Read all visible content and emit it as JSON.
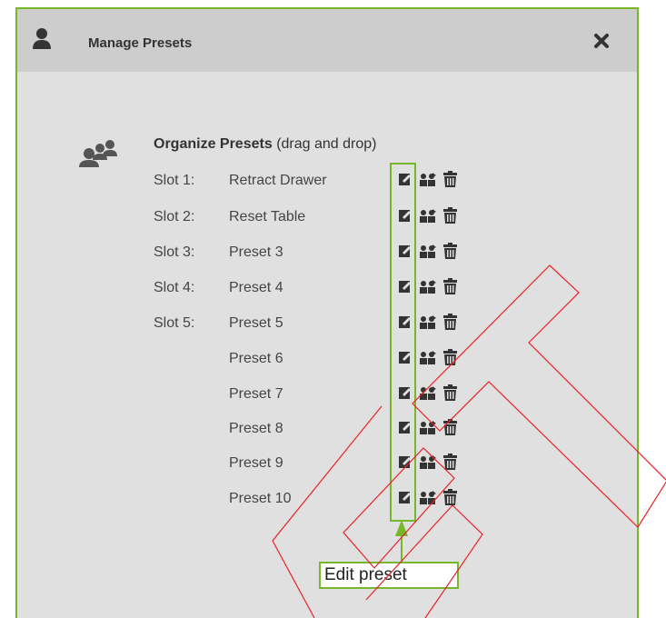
{
  "dialog": {
    "title": "Manage Presets",
    "heading_bold": "Organize Presets",
    "heading_hint": "(drag and drop)"
  },
  "slots": [
    {
      "slot": "Slot 1:",
      "name": "Retract Drawer"
    },
    {
      "slot": "Slot 2:",
      "name": "Reset Table"
    },
    {
      "slot": "Slot 3:",
      "name": "Preset 3"
    },
    {
      "slot": "Slot 4:",
      "name": "Preset 4"
    },
    {
      "slot": "Slot 5:",
      "name": "Preset 5"
    },
    {
      "slot": "",
      "name": "Preset 6"
    },
    {
      "slot": "",
      "name": "Preset 7"
    },
    {
      "slot": "",
      "name": "Preset 8"
    },
    {
      "slot": "",
      "name": "Preset 9"
    },
    {
      "slot": "",
      "name": "Preset 10"
    }
  ],
  "callout": {
    "label": "Edit preset"
  },
  "icons": {
    "user": "user-icon",
    "close": "close-icon",
    "group": "group-icon",
    "edit": "edit-icon",
    "link": "link-users-icon",
    "delete": "trash-icon"
  },
  "colors": {
    "highlight": "#76b82a",
    "watermark": "#e8222a",
    "header_bg": "#cdcdcd",
    "body_bg": "#e0e0e0"
  }
}
